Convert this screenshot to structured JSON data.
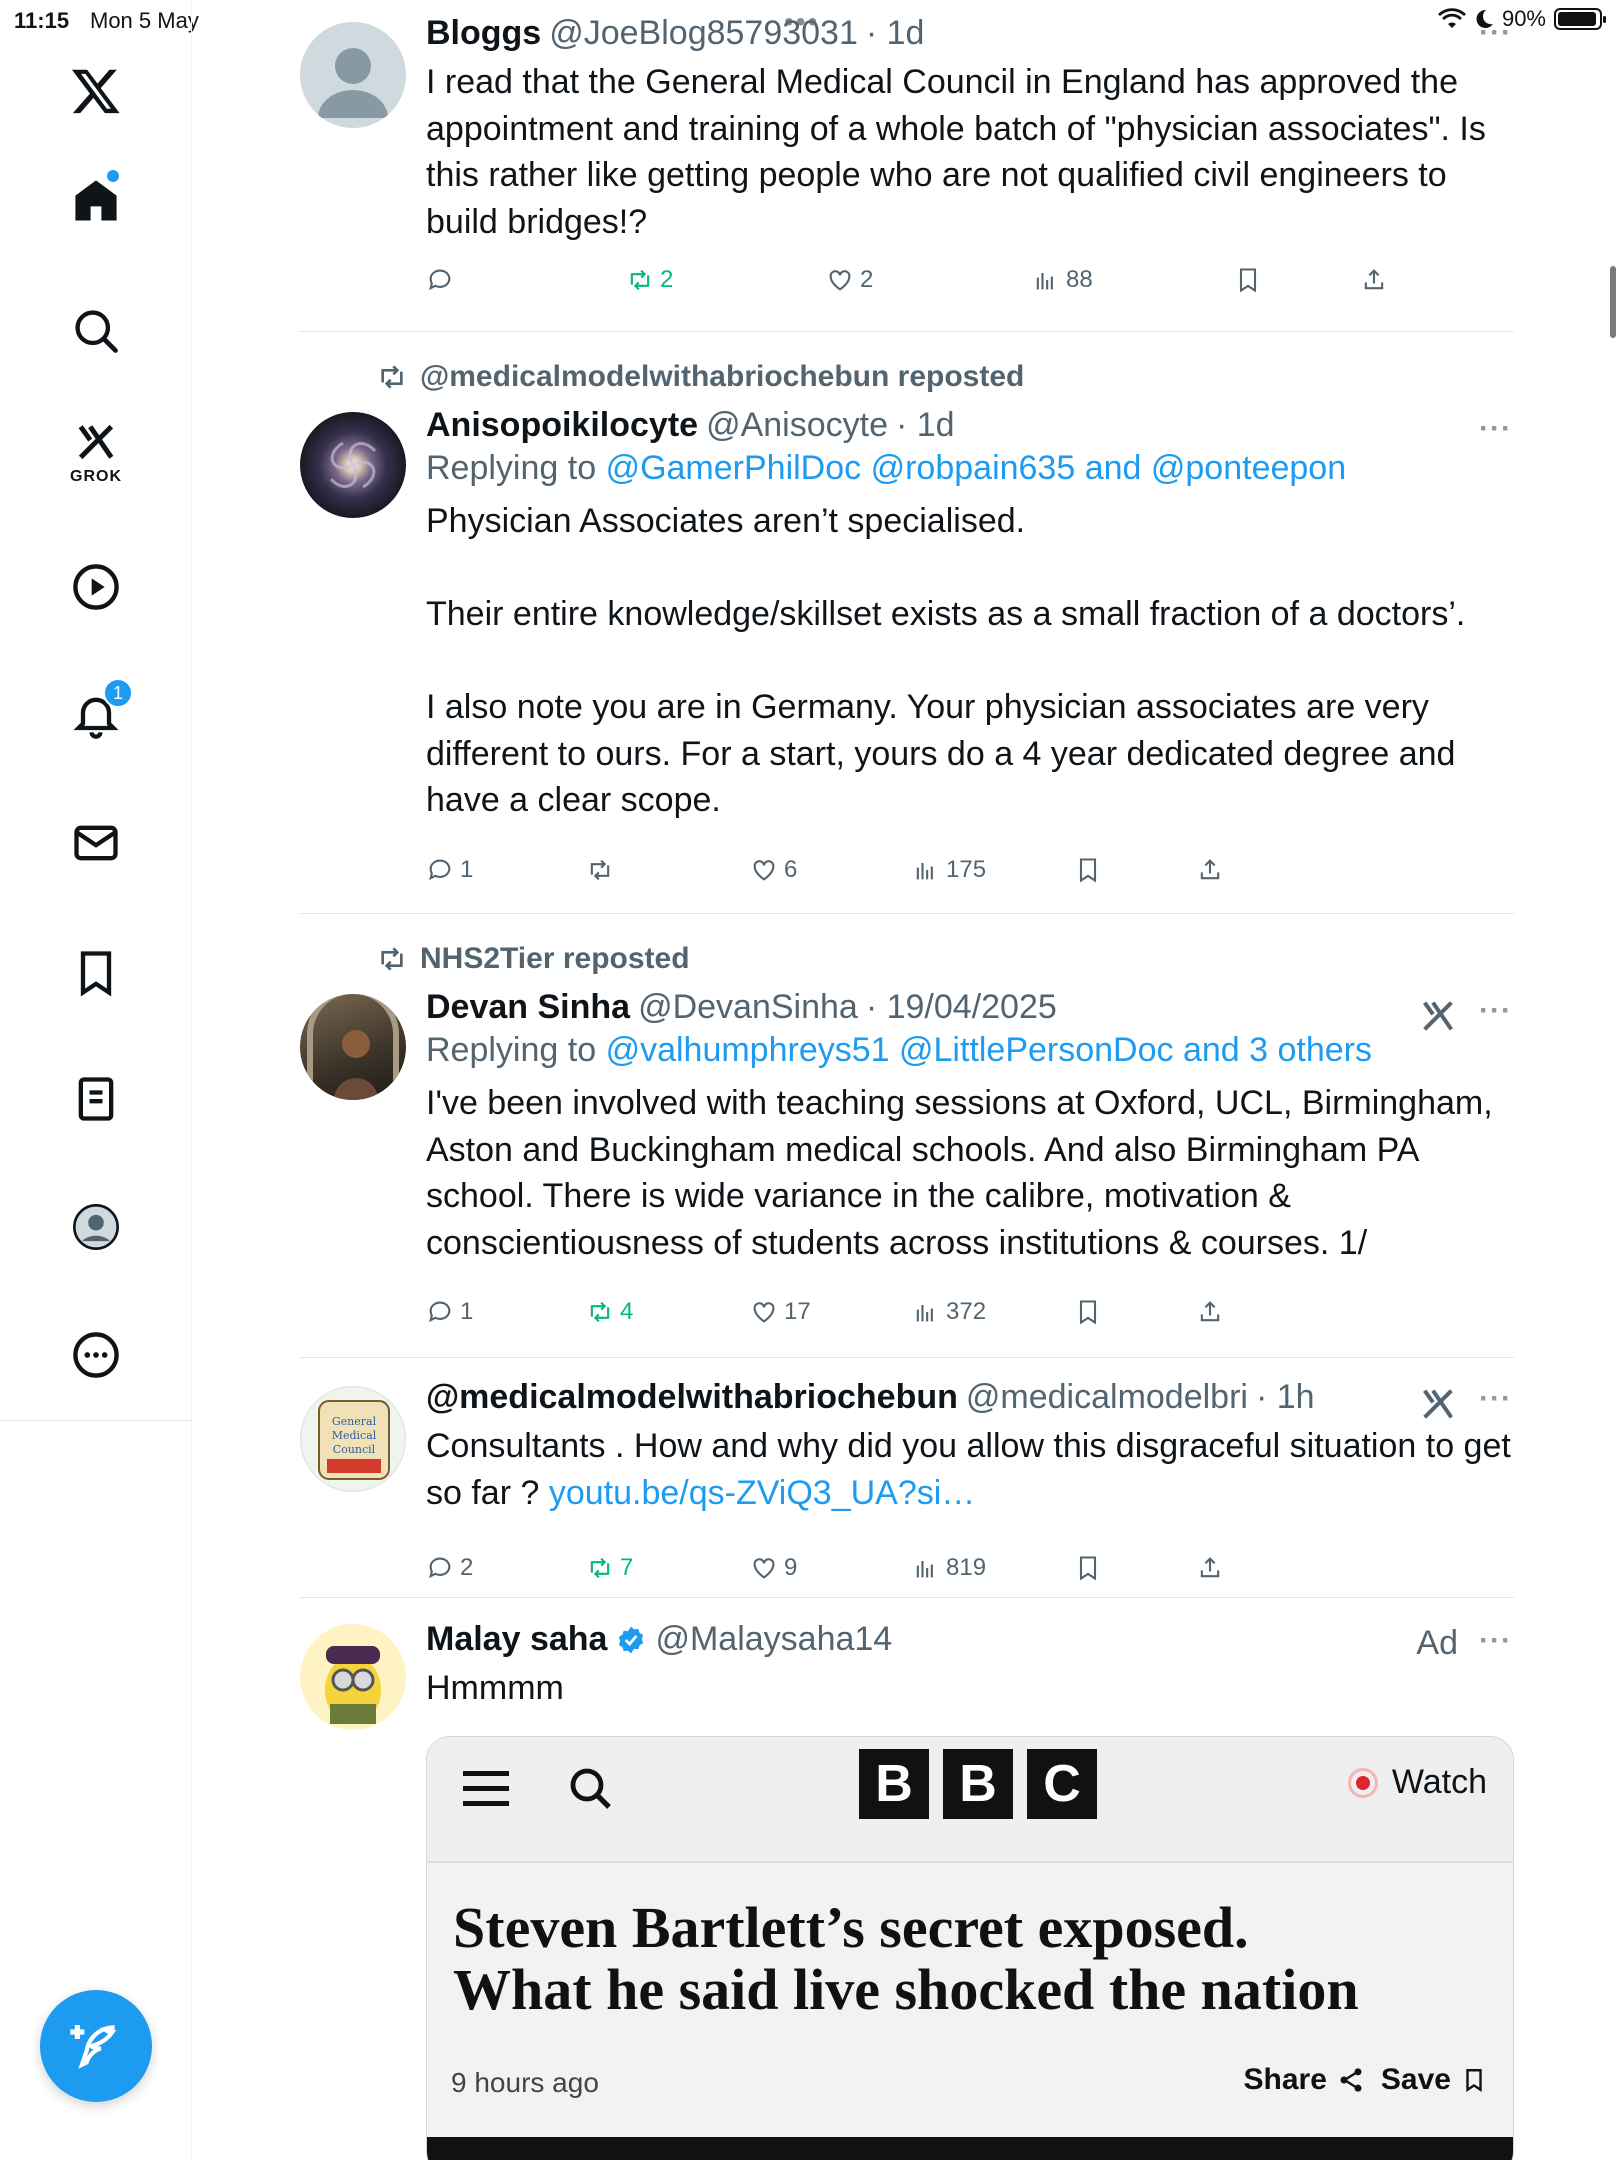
{
  "status_bar": {
    "time": "11:15",
    "date": "Mon 5 May",
    "battery": "90%"
  },
  "sidebar": {
    "grok_label": "GROK",
    "notifications_count": "1",
    "items": [
      "home-icon",
      "search-icon",
      "grok-icon",
      "video-icon",
      "notifications-icon",
      "messages-icon",
      "bookmarks-icon",
      "lists-icon",
      "profile-icon",
      "more-icon"
    ]
  },
  "tweets": [
    {
      "name": "Bloggs",
      "handle": "@JoeBlog85793031",
      "time": "· 1d",
      "body": "I read that the General Medical Council in England has approved the appointment and training of a whole batch of \"physician associates\". Is this rather like getting people who are not qualified civil engineers to build bridges!?",
      "replies": "",
      "reposts": "2",
      "likes": "2",
      "views": "88"
    },
    {
      "repost_by": "@medicalmodelwithabriochebun reposted",
      "name": "Anisopoikilocyte",
      "handle": "@Anisocyte",
      "time": "· 1d",
      "replying_label": "Replying to",
      "replying_to": "@GamerPhilDoc @robpain635 and @ponteepon",
      "body": "Physician Associates aren’t specialised.\n\nTheir entire knowledge/skillset exists as a small fraction of a doctors’.\n\nI also note you are in Germany. Your physician associates are very different to ours. For a start, yours do a 4 year dedicated degree and have a clear scope.",
      "replies": "1",
      "reposts": "",
      "likes": "6",
      "views": "175"
    },
    {
      "repost_by": "NHS2Tier reposted",
      "name": "Devan Sinha",
      "handle": "@DevanSinha",
      "time": "· 19/04/2025",
      "replying_label": "Replying to",
      "replying_to": "@valhumphreys51 @LittlePersonDoc and 3 others",
      "body": "I've been involved with teaching sessions at Oxford, UCL, Birmingham, Aston and Buckingham medical schools. And also Birmingham PA school. There is wide variance in the calibre, motivation & conscientiousness of students across institutions & courses. 1/",
      "replies": "1",
      "reposts": "4",
      "likes": "17",
      "views": "372"
    },
    {
      "name": "@medicalmodelwithabriochebun",
      "handle": "@medicalmodelbri",
      "time": "· 1h",
      "body": "Consultants . How and why did you allow this disgraceful situation to get so far ? ",
      "link": "youtu.be/qs-ZViQ3_UA?si…",
      "replies": "2",
      "reposts": "7",
      "likes": "9",
      "views": "819"
    },
    {
      "name": "Malay saha",
      "handle": "@Malaysaha14",
      "ad_label": "Ad",
      "body": "Hmmmm"
    }
  ],
  "ad_card": {
    "bbc_letters": [
      "B",
      "B",
      "C"
    ],
    "watch_label": "Watch",
    "headline_1": "Steven Bartlett’s secret exposed.",
    "headline_2": "What he said live shocked the nation",
    "time_ago": "9 hours ago",
    "share_label": "Share",
    "save_label": "Save"
  },
  "colors": {
    "accent": "#1d9bf0",
    "repost_green": "#00ba7c",
    "muted": "#536471"
  }
}
